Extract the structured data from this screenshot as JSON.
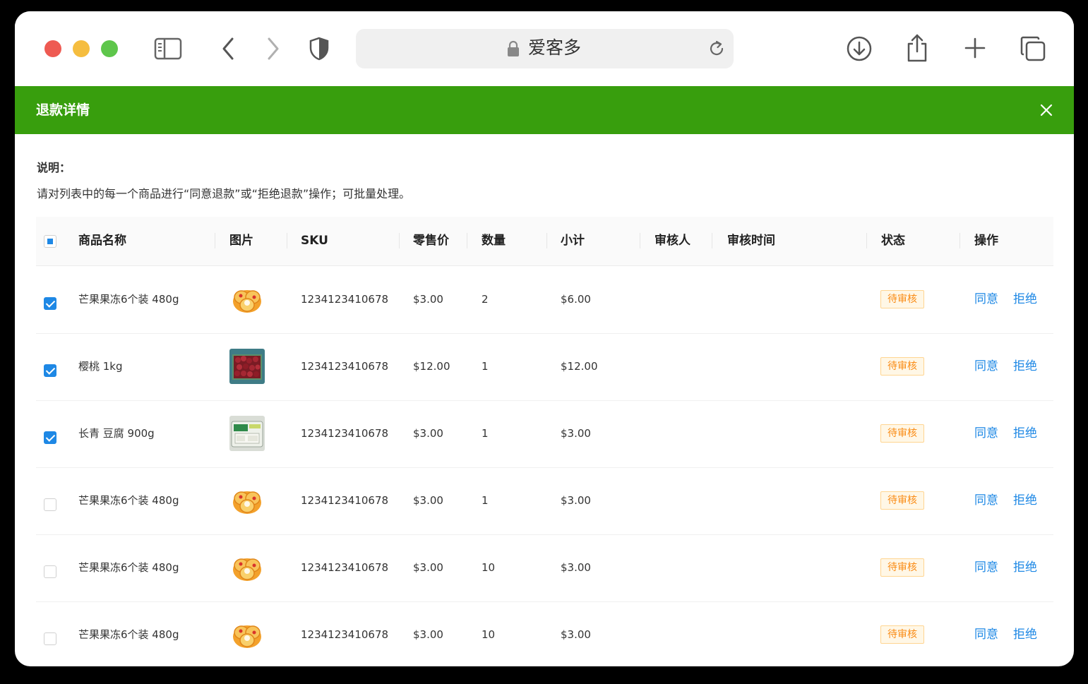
{
  "browser": {
    "address": "爱客多",
    "icons": {
      "sidebar": "sidebar-icon",
      "back": "chevron-left-icon",
      "forward": "chevron-right-icon",
      "shield": "shield-icon",
      "lock": "lock-icon",
      "reload": "reload-icon",
      "download": "download-icon",
      "share": "share-icon",
      "new_tab": "plus-icon",
      "tabs": "tabs-overview-icon"
    }
  },
  "dialog": {
    "title": "退款详情",
    "header_color": "#389e0d",
    "note_label": "说明：",
    "note_text": "请对列表中的每一个商品进行“同意退款”或“拒绝退款”操作；可批量处理。"
  },
  "table": {
    "columns": {
      "name": "商品名称",
      "image": "图片",
      "sku": "SKU",
      "price": "零售价",
      "qty": "数量",
      "subtotal": "小计",
      "reviewer": "审核人",
      "review_time": "审核时间",
      "status": "状态",
      "action": "操作"
    },
    "select_all_state": "indeterminate",
    "rows": [
      {
        "checked": true,
        "name": "芒果果冻6个装 480g",
        "image": "mango-jelly-image",
        "sku": "1234123410678",
        "price": "$3.00",
        "qty": "2",
        "subtotal": "$6.00",
        "reviewer": "",
        "review_time": "",
        "status": "待审核",
        "agree": "同意",
        "reject": "拒绝"
      },
      {
        "checked": true,
        "name": "樱桃 1kg",
        "image": "cherry-image",
        "sku": "1234123410678",
        "price": "$12.00",
        "qty": "1",
        "subtotal": "$12.00",
        "reviewer": "",
        "review_time": "",
        "status": "待审核",
        "agree": "同意",
        "reject": "拒绝"
      },
      {
        "checked": true,
        "name": "长青 豆腐 900g",
        "image": "tofu-image",
        "sku": "1234123410678",
        "price": "$3.00",
        "qty": "1",
        "subtotal": "$3.00",
        "reviewer": "",
        "review_time": "",
        "status": "待审核",
        "agree": "同意",
        "reject": "拒绝"
      },
      {
        "checked": false,
        "name": "芒果果冻6个装 480g",
        "image": "mango-jelly-image",
        "sku": "1234123410678",
        "price": "$3.00",
        "qty": "1",
        "subtotal": "$3.00",
        "reviewer": "",
        "review_time": "",
        "status": "待审核",
        "agree": "同意",
        "reject": "拒绝"
      },
      {
        "checked": false,
        "name": "芒果果冻6个装 480g",
        "image": "mango-jelly-image",
        "sku": "1234123410678",
        "price": "$3.00",
        "qty": "10",
        "subtotal": "$3.00",
        "reviewer": "",
        "review_time": "",
        "status": "待审核",
        "agree": "同意",
        "reject": "拒绝"
      },
      {
        "checked": false,
        "name": "芒果果冻6个装 480g",
        "image": "mango-jelly-image",
        "sku": "1234123410678",
        "price": "$3.00",
        "qty": "10",
        "subtotal": "$3.00",
        "reviewer": "",
        "review_time": "",
        "status": "待审核",
        "agree": "同意",
        "reject": "拒绝"
      }
    ]
  },
  "colors": {
    "accent": "#1e88e5",
    "status_text": "#fa8c16",
    "status_bg": "#fff7e6",
    "status_border": "#ffd591"
  }
}
